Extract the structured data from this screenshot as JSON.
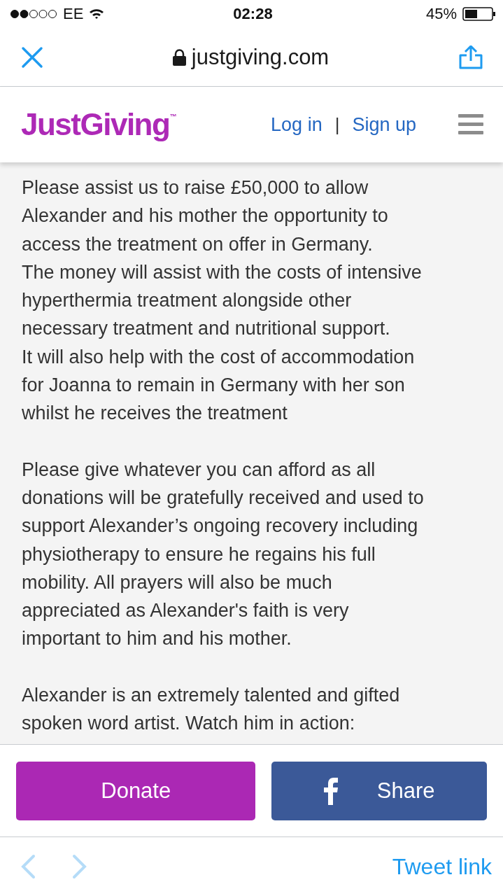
{
  "status_bar": {
    "carrier": "EE",
    "time": "02:28",
    "battery": "45%"
  },
  "browser_bar": {
    "url": "justgiving.com"
  },
  "header": {
    "logo": "JustGiving",
    "logo_mark": "™",
    "login": "Log in",
    "separator": "|",
    "signup": "Sign up"
  },
  "paragraphs": [
    [
      "Please assist us to raise £50,000 to allow",
      "Alexander and his mother the opportunity to",
      "access the treatment on offer in Germany.",
      "The money will assist with the costs of intensive",
      "hyperthermia treatment alongside other",
      "necessary treatment and nutritional support.",
      "It will also help with the cost of accommodation",
      "for Joanna to remain in Germany with her son",
      "whilst he receives the treatment"
    ],
    [
      "Please give whatever you can afford as all",
      "donations will be gratefully received and used to",
      "support Alexander’s ongoing recovery including",
      "physiotherapy to ensure he regains his full",
      "mobility. All prayers will also be much",
      "appreciated as Alexander's faith is very",
      "important to him and his mother."
    ],
    [
      "Alexander is an extremely talented and gifted",
      "spoken word artist. Watch him in action:"
    ]
  ],
  "actions": {
    "donate": "Donate",
    "share": "Share"
  },
  "toolbar": {
    "back": {
      "disabled": true
    },
    "forward": {
      "disabled": true
    },
    "tweet": "Tweet link"
  }
}
